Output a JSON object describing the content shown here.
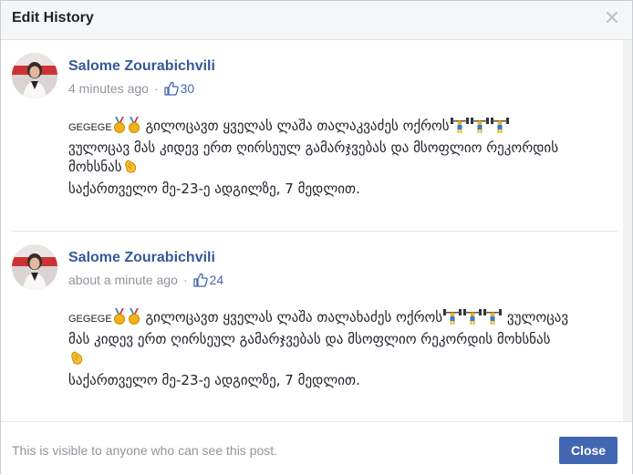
{
  "dialog": {
    "title": "Edit History",
    "close_icon": "close-icon"
  },
  "entries": [
    {
      "author": "Salome Zourabichvili",
      "time": "4 minutes ago",
      "likes": "30",
      "line1_prefix": "GEGEGE",
      "line1_text": "გილოცავთ ყველას ლაშა თალაკვაძეს ოქროს",
      "line2_text": "ვულოცავ მას კიდევ ერთ ღირსეულ გამარჯვებას და მსოფლიო რეკორდის",
      "line3_text": "მოხსნას",
      "line4_text": "საქართველო მე-23-ე ადგილზე, 7 მედლით."
    },
    {
      "author": "Salome Zourabichvili",
      "time": "about a minute ago",
      "likes": "24",
      "line1_prefix": "GEGEGE",
      "line1_text": "გილოცავთ ყველას ლაშა თალახაძეს ოქროს",
      "line1_suffix": "ვულოცავ",
      "line2_text": "მას კიდევ ერთ ღირსეულ გამარჯვებას და მსოფლიო რეკორდის მოხსნას",
      "line4_text": "საქართველო მე-23-ე ადგილზე, 7 მედლით."
    }
  ],
  "footer": {
    "note": "This is visible to anyone who can see this post.",
    "close_label": "Close"
  },
  "icons": [
    "medal-icon",
    "weightlifter-icon",
    "clap-icon",
    "like-icon",
    "avatar"
  ],
  "colors": {
    "accent": "#4267b2",
    "name": "#365899",
    "muted": "#90949c"
  }
}
